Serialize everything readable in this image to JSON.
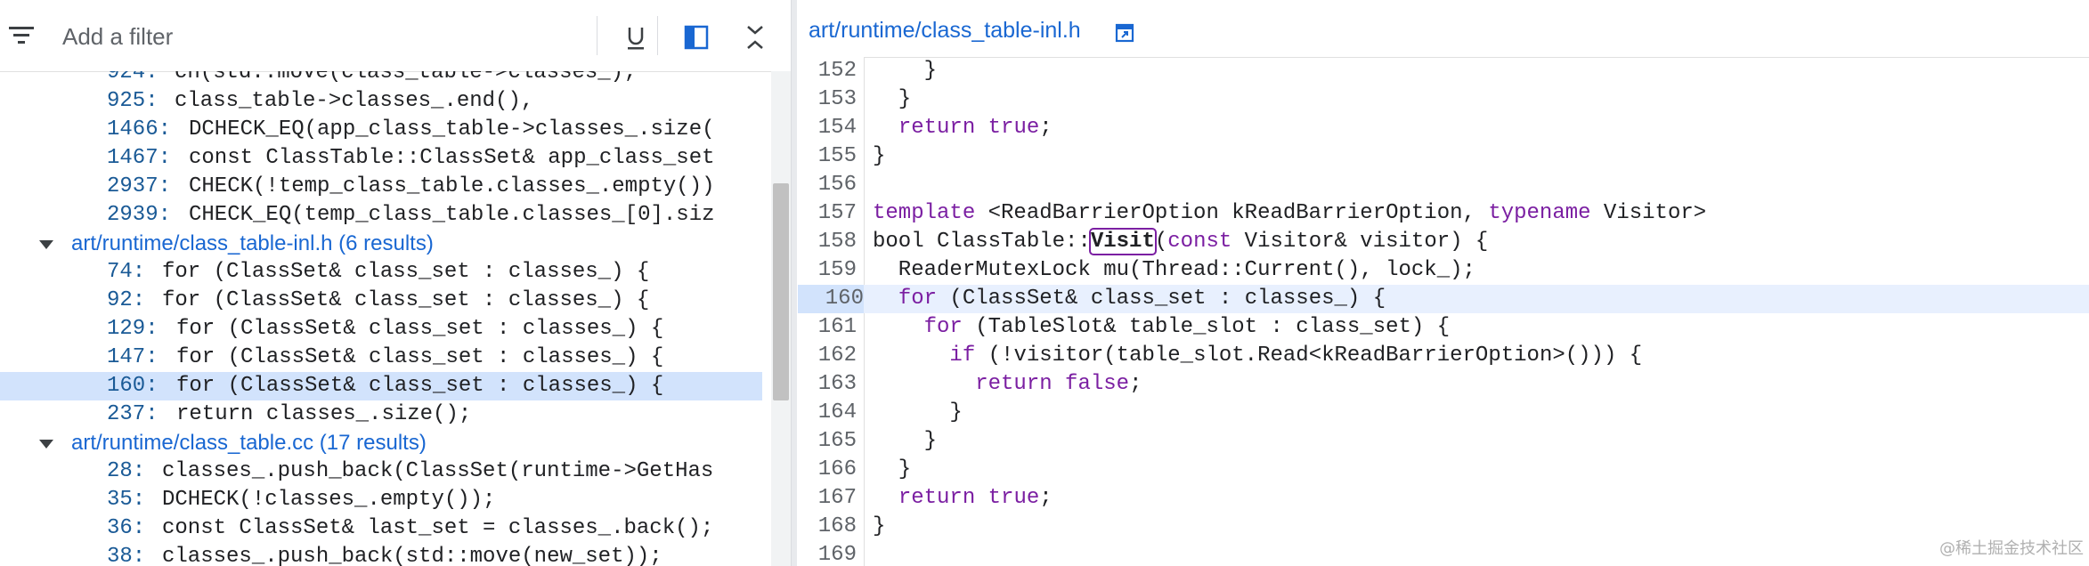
{
  "filter": {
    "placeholder": "Add a filter"
  },
  "toolbar": {
    "filter_icon": "filter-list-icon",
    "underline_icon": "underline-icon",
    "split_icon": "split-view-icon",
    "collapse_icon": "collapse-all-icon"
  },
  "results": {
    "partial_top": "ch(std::move(class_table->classes_);",
    "group0_rows": [
      {
        "line": "925:",
        "code": "class_table->classes_.end(),"
      },
      {
        "line": "1466:",
        "code": "DCHECK_EQ(app_class_table->classes_.size("
      },
      {
        "line": "1467:",
        "code": "const ClassTable::ClassSet& app_class_set"
      },
      {
        "line": "2937:",
        "code": "CHECK(!temp_class_table.classes_.empty())"
      },
      {
        "line": "2939:",
        "code": "CHECK_EQ(temp_class_table.classes_[0].siz"
      }
    ],
    "group1": {
      "label": "art/runtime/class_table-inl.h (6 results)",
      "rows": [
        {
          "line": "74:",
          "code": "for (ClassSet& class_set : classes_) {"
        },
        {
          "line": "92:",
          "code": "for (ClassSet& class_set : classes_) {"
        },
        {
          "line": "129:",
          "code": "for (ClassSet& class_set : classes_) {"
        },
        {
          "line": "147:",
          "code": "for (ClassSet& class_set : classes_) {"
        },
        {
          "line": "160:",
          "code": "for (ClassSet& class_set : classes_) {"
        },
        {
          "line": "237:",
          "code": "return classes_.size();"
        }
      ]
    },
    "group2": {
      "label": "art/runtime/class_table.cc (17 results)",
      "rows": [
        {
          "line": "28:",
          "code": "classes_.push_back(ClassSet(runtime->GetHas"
        },
        {
          "line": "35:",
          "code": "DCHECK(!classes_.empty());"
        },
        {
          "line": "36:",
          "code": "const ClassSet& last_set = classes_.back();"
        },
        {
          "line": "38:",
          "code": "classes_.push_back(std::move(new_set));"
        }
      ]
    }
  },
  "editor": {
    "file_path": "art/runtime/class_table-inl.h",
    "open_icon": "open-in-new-icon",
    "current_line": 160,
    "lines": [
      {
        "n": "152",
        "t": "    }"
      },
      {
        "n": "153",
        "t": "  }"
      },
      {
        "n": "154",
        "t": "  return true;"
      },
      {
        "n": "155",
        "t": "}"
      },
      {
        "n": "156",
        "t": ""
      },
      {
        "n": "157",
        "t": "template <ReadBarrierOption kReadBarrierOption, typename Visitor>"
      },
      {
        "n": "158",
        "t": "bool ClassTable::Visit(const Visitor& visitor) {"
      },
      {
        "n": "159",
        "t": "  ReaderMutexLock mu(Thread::Current(), lock_);"
      },
      {
        "n": "160",
        "t": "  for (ClassSet& class_set : classes_) {"
      },
      {
        "n": "161",
        "t": "    for (TableSlot& table_slot : class_set) {"
      },
      {
        "n": "162",
        "t": "      if (!visitor(table_slot.Read<kReadBarrierOption>())) {"
      },
      {
        "n": "163",
        "t": "        return false;"
      },
      {
        "n": "164",
        "t": "      }"
      },
      {
        "n": "165",
        "t": "    }"
      },
      {
        "n": "166",
        "t": "  }"
      },
      {
        "n": "167",
        "t": "  return true;"
      },
      {
        "n": "168",
        "t": "}"
      },
      {
        "n": "169",
        "t": ""
      }
    ]
  },
  "watermark": "@稀土掘金技术社区",
  "colors": {
    "link": "#1967d2",
    "keyword": "#7b1fa2",
    "selection": "#d2e3fc"
  }
}
